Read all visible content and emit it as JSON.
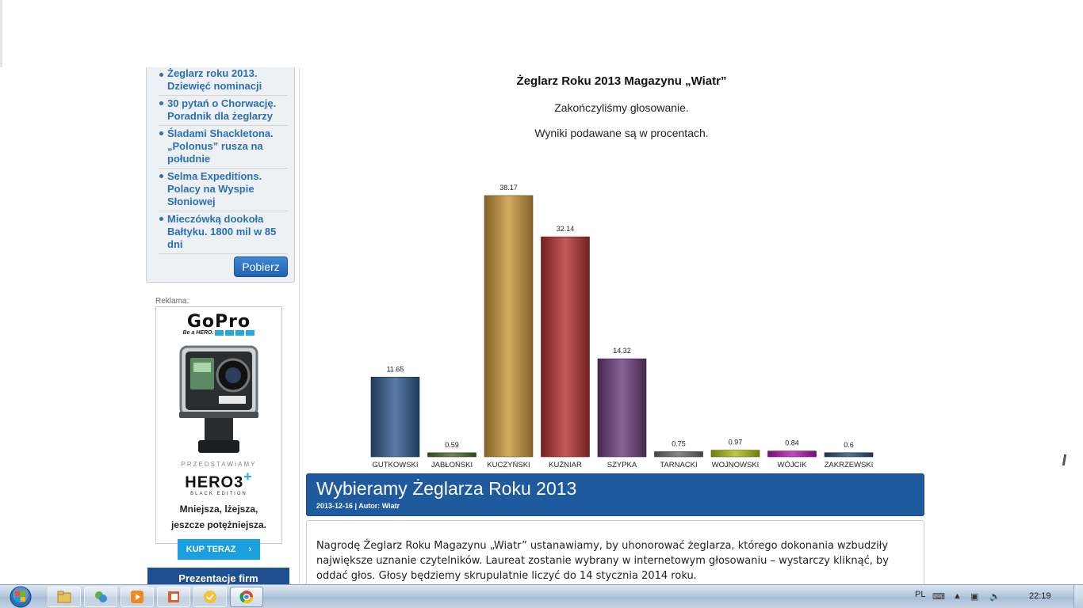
{
  "sidebar": {
    "news_items": [
      "Żeglarz roku 2013. Dziewięć nominacji",
      "30 pytań o Chorwację. Poradnik dla żeglarzy",
      "Śladami Shackletona. „Polonus” rusza na południe",
      "Selma Expeditions. Polacy na Wyspie Słoniowej",
      "Mieczówką dookoła Bałtyku. 1800 mil w 85 dni"
    ],
    "download_button": "Pobierz",
    "ad_label": "Reklama:",
    "ad": {
      "logo": "GoPro",
      "tagline": "Be a HERO.",
      "intro": "PRZEDSTAWIAMY",
      "product": "HERO3",
      "product_plus": "+",
      "edition": "BLACK EDITION",
      "copy_line1": "Mniejsza, lżejsza,",
      "copy_line2": "jeszcze potężniejsza.",
      "cta": "KUP TERAZ",
      "cta_icon": "chevron-right-icon"
    },
    "section_header": "Prezentacje firm"
  },
  "chart_data": {
    "type": "bar",
    "title": "Żeglarz Roku 2013 Magazynu „Wiatr”",
    "subtitle_lines": [
      "Zakończyliśmy głosowanie.",
      "Wyniki podawane są w procentach."
    ],
    "categories": [
      "GUTKOWSKI",
      "JABŁOŃSKI",
      "KUCZYŃSKI",
      "KUŹNIAR",
      "SZYPKA",
      "TARNACKI",
      "WOJNOWSKI",
      "WÓJCIK",
      "ZAKRZEWSKI"
    ],
    "values": [
      11.65,
      0.59,
      38.17,
      32.14,
      14.32,
      0.75,
      0.97,
      0.84,
      0.6
    ],
    "value_labels": [
      "11.65",
      "0.59",
      "38.17",
      "32.14",
      "14.32",
      "0.75",
      "0.97",
      "0.84",
      "0.6"
    ],
    "colors": [
      "#2f5b8e",
      "#4a6b2c",
      "#c8963a",
      "#b4302f",
      "#6b3d7c",
      "#6a6a6a",
      "#a9bf12",
      "#b419b7",
      "#2d4f78"
    ],
    "grid": false,
    "legend": "none"
  },
  "article": {
    "title": "Wybieramy Żeglarza Roku 2013",
    "meta": "2013-12-16 | Autor: Wiatr",
    "body_line1": "Nagrodę Żeglarz Roku Magazynu „Wiatr” ustanawiamy, by uhonorować żeglarza, którego dokonania wzbudziły",
    "body_line2": "największe uznanie czytelników. Laureat zostanie wybrany w internetowym głosowaniu – wystarczy kliknąć, by",
    "body_line3": "oddać głos. Głosy będziemy skrupulatnie liczyć do 14 stycznia 2014 roku."
  },
  "taskbar": {
    "start": "windows-start-icon",
    "apps": [
      "explorer-icon",
      "messenger-icon",
      "media-player-icon",
      "office-icon",
      "notes-icon",
      "chrome-icon"
    ],
    "language": "PL",
    "clock": "22:19"
  }
}
